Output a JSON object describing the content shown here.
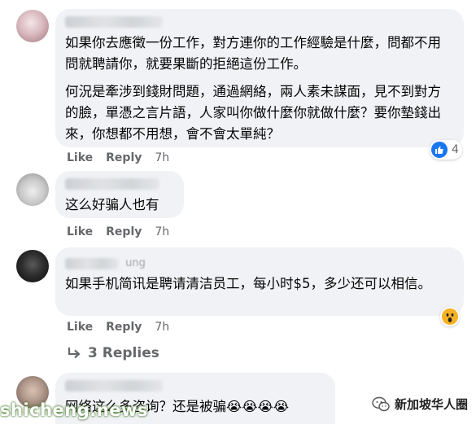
{
  "comments": [
    {
      "text_1": "如果你去應徵一份工作，對方連你的工作經驗是什麼，問都不用問就聘請你，就要果斷的拒絕這份工作。",
      "text_2": "何況是牽涉到錢財問題，通過網絡，兩人素未謀面，見不到對方的臉，單憑之言片語，人家叫你做什麼你就做什麼？要你墊錢出來，你想都不用想，會不會太單純？",
      "like_label": "Like",
      "reply_label": "Reply",
      "time": "7h",
      "reaction_count": "4",
      "reaction_icon": "thumbs-up-icon"
    },
    {
      "text_1": "这么好骗人也有",
      "like_label": "Like",
      "reply_label": "Reply",
      "time": "7h"
    },
    {
      "name_fragment": "ung",
      "text_1": "如果手机简讯是聘请清洁员工，每小时$5，多少还可以相信。",
      "like_label": "Like",
      "reply_label": "Reply",
      "time": "7h",
      "reaction_icon": "wow-icon",
      "replies_label": "3 Replies"
    },
    {
      "text_1": "网络这么多咨询？还是被骗😭😭😭😭"
    }
  ],
  "watermark": {
    "left": "shicheng.news",
    "right": "新加坡华人圈"
  },
  "colors": {
    "bubble": "#f0f2f5",
    "meta": "#65676b",
    "like_blue": "#1877f2",
    "wow_yellow": "#f7b125"
  }
}
